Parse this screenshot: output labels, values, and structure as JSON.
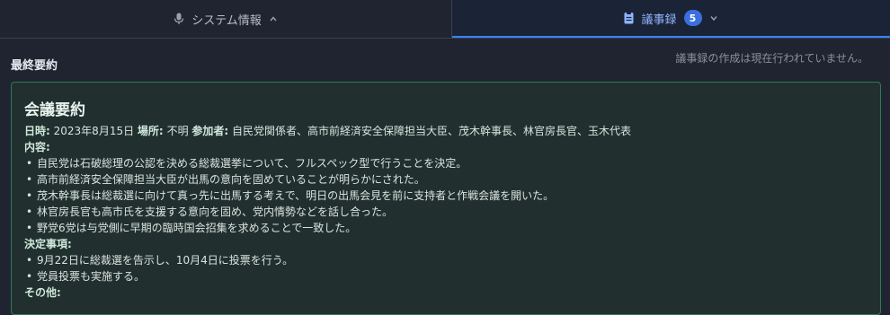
{
  "tabs": {
    "system": {
      "label": "システム情報",
      "icon": "microphone-icon",
      "chevron": "chevron-up-icon"
    },
    "minutes": {
      "label": "議事録",
      "icon": "document-icon",
      "badge": "5",
      "chevron": "chevron-down-icon"
    }
  },
  "section": {
    "title": "最終要約",
    "status": "議事録の作成は現在行われていません。"
  },
  "summary": {
    "title": "会議要約",
    "meta": {
      "date_label": "日時:",
      "date": "2023年8月15日",
      "place_label": "場所:",
      "place": "不明",
      "attendees_label": "参加者:",
      "attendees": "自民党関係者、高市前経済安全保障担当大臣、茂木幹事長、林官房長官、玉木代表"
    },
    "content_heading": "内容:",
    "content_items": [
      "自民党は石破総理の公認を決める総裁選挙について、フルスペック型で行うことを決定。",
      "高市前経済安全保障担当大臣が出馬の意向を固めていることが明らかにされた。",
      "茂木幹事長は総裁選に向けて真っ先に出馬する考えで、明日の出馬会見を前に支持者と作戦会議を開いた。",
      "林官房長官も高市氏を支援する意向を固め、党内情勢などを話し合った。",
      "野党6党は与党側に早期の臨時国会招集を求めることで一致した。"
    ],
    "decisions_heading": "決定事項:",
    "decision_items": [
      "9月22日に総裁選を告示し、10月4日に投票を行う。",
      "党員投票も実施する。"
    ],
    "other_heading": "その他:"
  },
  "colors": {
    "background": "#1f2430",
    "accent": "#3b82f6",
    "card_border": "#2f7a52",
    "card_bg": "#21302f"
  }
}
